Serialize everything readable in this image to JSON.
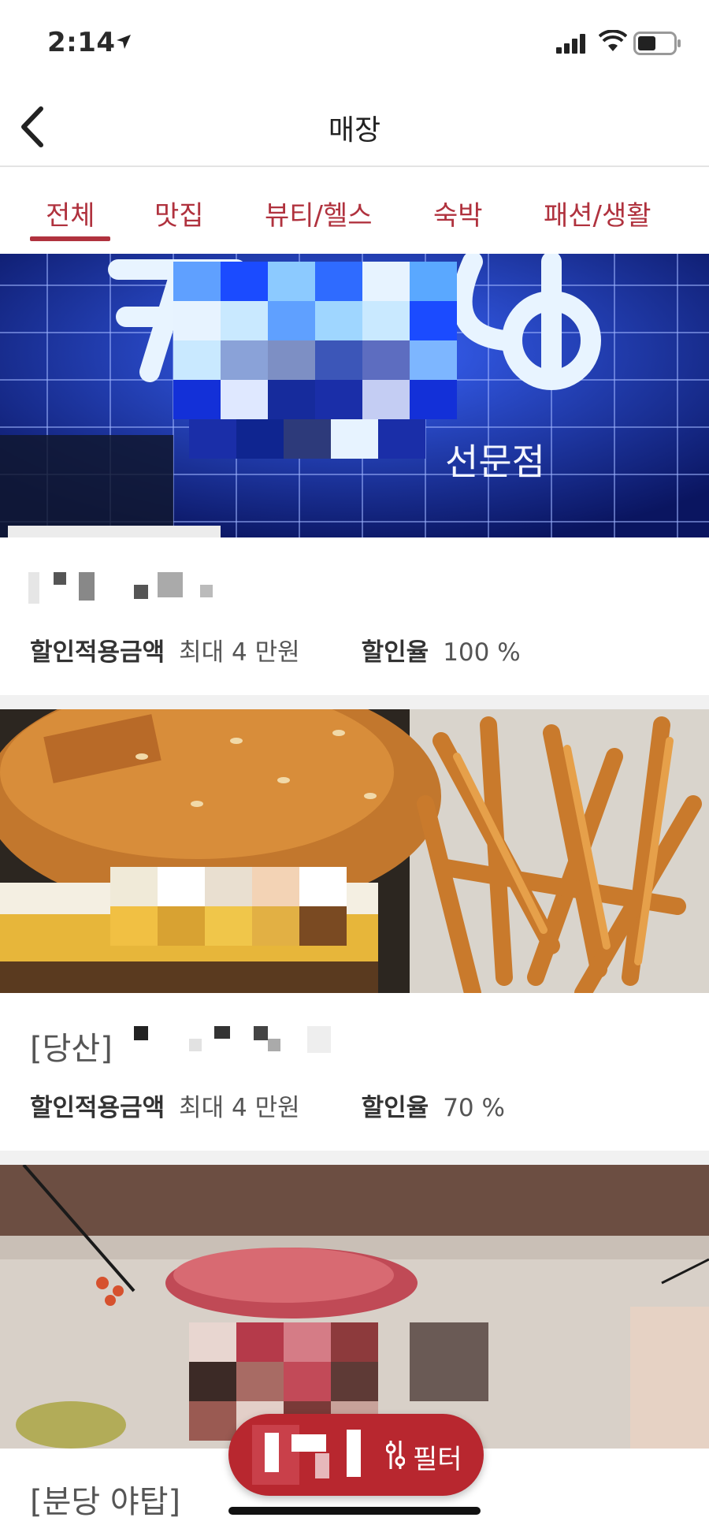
{
  "status_bar": {
    "time": "2:14"
  },
  "header": {
    "title": "매장"
  },
  "tabs": [
    {
      "label": "전체",
      "selected": true
    },
    {
      "label": "맛집"
    },
    {
      "label": "뷰티/헬스"
    },
    {
      "label": "숙박"
    },
    {
      "label": "패션/생활"
    }
  ],
  "cards": [
    {
      "image_text": "선문점",
      "name": "",
      "discount_amount_label": "할인적용금액",
      "discount_amount": "최대 4 만원",
      "discount_rate_label": "할인율",
      "discount_rate": "100 %"
    },
    {
      "name": "[당산]",
      "discount_amount_label": "할인적용금액",
      "discount_amount": "최대 4 만원",
      "discount_rate_label": "할인율",
      "discount_rate": "70 %"
    },
    {
      "name": "[분당 야탑]"
    }
  ],
  "filter_button": {
    "label": "필터"
  },
  "colors": {
    "accent": "#b0323e",
    "filter_bg": "#b8272f"
  }
}
